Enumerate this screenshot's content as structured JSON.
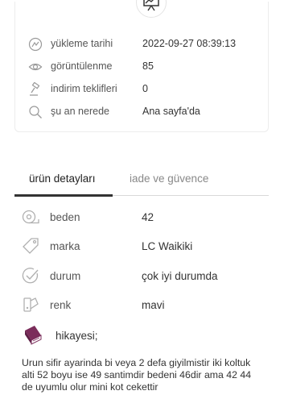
{
  "stats": {
    "rows": [
      {
        "icon": "upload-date-icon",
        "label": "yükleme tarihi",
        "value": "2022-09-27 08:39:13"
      },
      {
        "icon": "eye-icon",
        "label": "görüntülenme",
        "value": "85"
      },
      {
        "icon": "gavel-icon",
        "label": "indirim teklifleri",
        "value": "0"
      },
      {
        "icon": "search-icon",
        "label": "şu an nerede",
        "value": "Ana sayfa'da"
      }
    ]
  },
  "tabs": [
    {
      "label": "ürün detayları",
      "active": true
    },
    {
      "label": "iade ve güvence",
      "active": false
    }
  ],
  "details": [
    {
      "icon": "tape-measure-icon",
      "label": "beden",
      "value": "42"
    },
    {
      "icon": "tag-icon",
      "label": "marka",
      "value": "LC Waikiki"
    },
    {
      "icon": "check-circle-icon",
      "label": "durum",
      "value": "çok iyi durumda"
    },
    {
      "icon": "color-swatch-icon",
      "label": "renk",
      "value": "mavi"
    }
  ],
  "story": {
    "label": "hikayesi;",
    "text": "Urun sifir ayarinda bi veya 2 defa giyilmistir iki koltuk alti 52 boyu ise 49 santimdir bedeni 46dir ama 42 44 de uyumlu olur mini kot cekettir"
  },
  "colors": {
    "accent": "#7b2d5b",
    "border": "#ececec",
    "icon_gray": "#9a9a9a"
  }
}
